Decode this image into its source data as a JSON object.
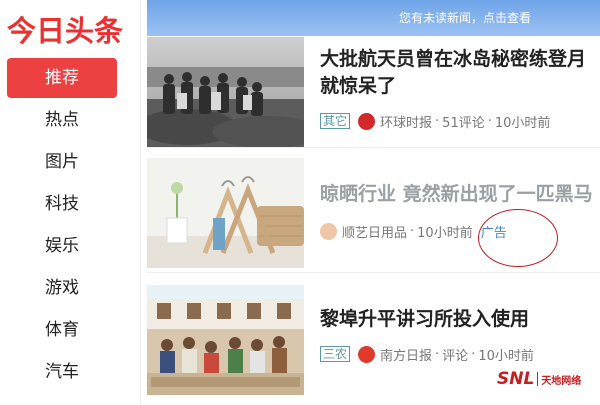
{
  "logo": "今日头条",
  "nav": [
    {
      "label": "推荐",
      "active": true
    },
    {
      "label": "热点"
    },
    {
      "label": "图片"
    },
    {
      "label": "科技"
    },
    {
      "label": "娱乐"
    },
    {
      "label": "游戏"
    },
    {
      "label": "体育"
    },
    {
      "label": "汽车"
    }
  ],
  "banner": {
    "text": "您有未读新闻，点击查看"
  },
  "feed": [
    {
      "title_line1": "大批航天员曾在冰岛秘密练登月",
      "title_line2": "就惊呆了",
      "tag": "其它",
      "source": "环球时报",
      "comments": "51评论",
      "time": "10小时前",
      "source_icon": "red-seal-icon"
    },
    {
      "title_line1": "晾晒行业 竟然新出现了一匹黑马",
      "source": "顺艺日用品",
      "time": "10小时前",
      "ad_label": "广告",
      "source_icon": "peach-circle-icon"
    },
    {
      "title_line1": "黎埠升平讲习所投入使用",
      "tag": "三农",
      "source": "南方日报",
      "comments": "评论",
      "time": "10小时前",
      "source_icon": "red-circle-icon"
    }
  ],
  "meta_sep": "·",
  "watermark": {
    "brand": "SNL",
    "name": "天地网络"
  },
  "colors": {
    "accent": "#ed4040",
    "banner": "#7eaeeb",
    "ad": "#4a8ac8",
    "tag": "#5a98a6"
  }
}
